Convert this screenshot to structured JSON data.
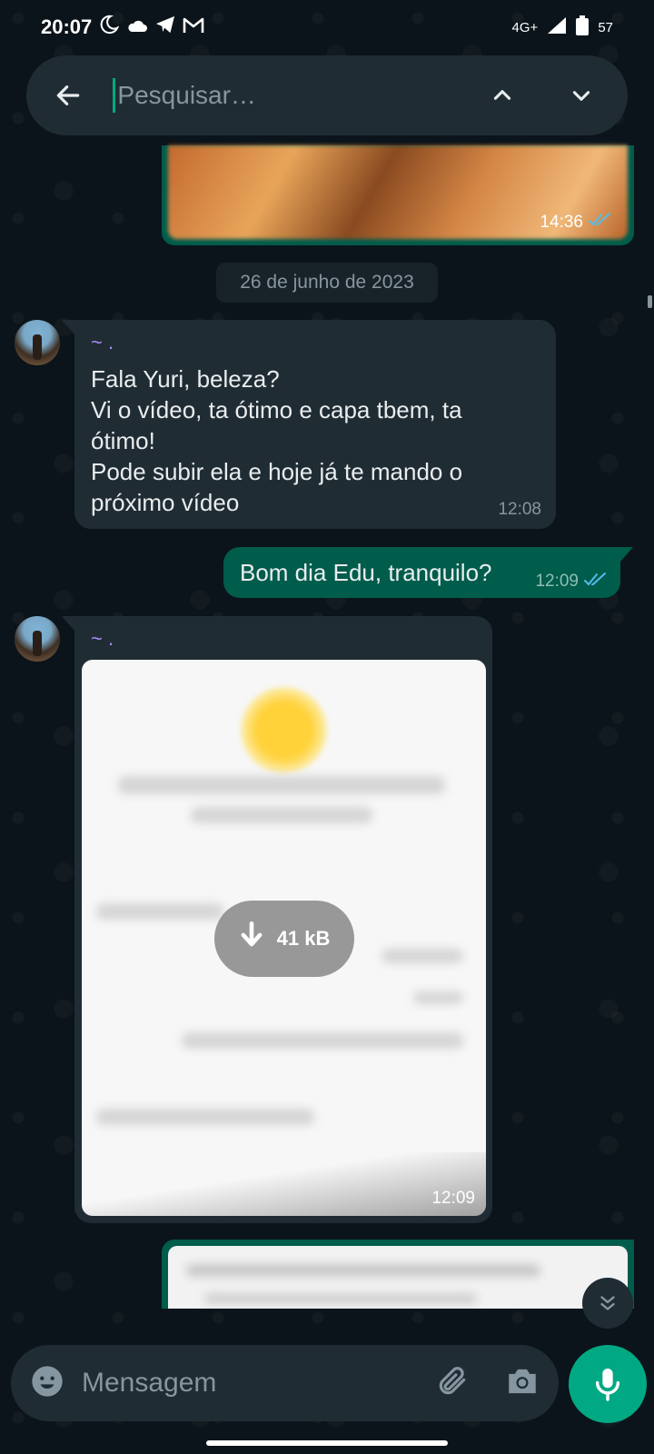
{
  "status_bar": {
    "time": "20:07",
    "network": "4G+",
    "battery": "57",
    "icons": [
      "moon-icon",
      "cloud-icon",
      "telegram-icon",
      "gmail-icon",
      "signal-icon",
      "battery-icon"
    ]
  },
  "search": {
    "placeholder": "Pesquisar…",
    "value": ""
  },
  "messages": {
    "top_image_time": "14:36",
    "date_chip": "26 de junho de 2023",
    "incoming_1": {
      "sender": "~ .",
      "lines": [
        "Fala Yuri, beleza?",
        "Vi o vídeo, ta ótimo e capa tbem, ta",
        "ótimo!",
        "Pode subir ela e hoje já te mando o",
        "próximo vídeo"
      ],
      "time": "12:08"
    },
    "outgoing_1": {
      "text": "Bom dia Edu, tranquilo?",
      "time": "12:09"
    },
    "incoming_2": {
      "sender": "~ .",
      "download_size": "41 kB",
      "time": "12:09"
    }
  },
  "composer": {
    "placeholder": "Mensagem"
  },
  "colors": {
    "background": "#0b141a",
    "incoming_bubble": "#202c33",
    "outgoing_bubble": "#005c4b",
    "accent": "#00a884",
    "read_ticks": "#53bdeb",
    "sender_name": "#a78bfa"
  }
}
